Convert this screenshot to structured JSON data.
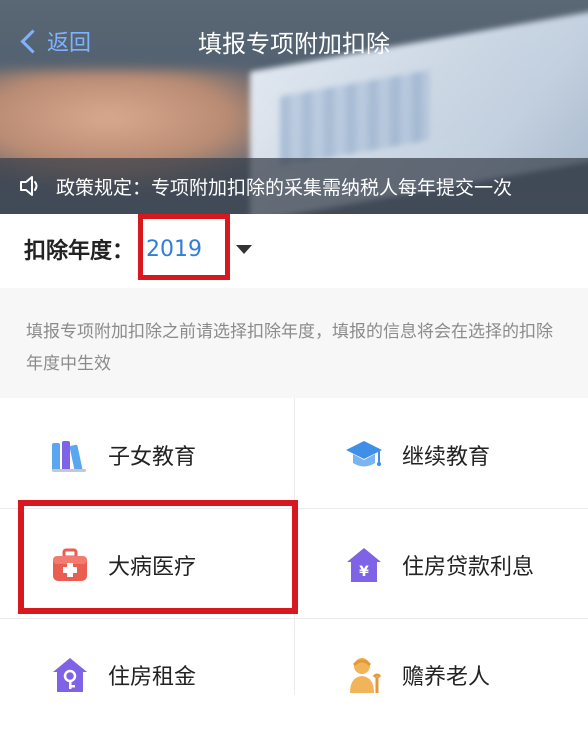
{
  "header": {
    "back_label": "返回",
    "title": "填报专项附加扣除",
    "notice": "政策规定：专项附加扣除的采集需纳税人每年提交一次"
  },
  "year_selector": {
    "label": "扣除年度：",
    "value": "2019"
  },
  "hint": "填报专项附加扣除之前请选择扣除年度，填报的信息将会在选择的扣除年度中生效",
  "categories": [
    {
      "label": "子女教育",
      "icon": "books-icon"
    },
    {
      "label": "继续教育",
      "icon": "graduation-cap-icon"
    },
    {
      "label": "大病医疗",
      "icon": "medical-kit-icon"
    },
    {
      "label": "住房贷款利息",
      "icon": "house-yen-icon"
    },
    {
      "label": "住房租金",
      "icon": "house-key-icon"
    },
    {
      "label": "赡养老人",
      "icon": "elderly-icon"
    }
  ],
  "colors": {
    "accent_blue": "#2f7fd8",
    "highlight_red": "#d7191f",
    "icon_purple": "#7e63e6",
    "icon_red": "#ea5d51"
  }
}
